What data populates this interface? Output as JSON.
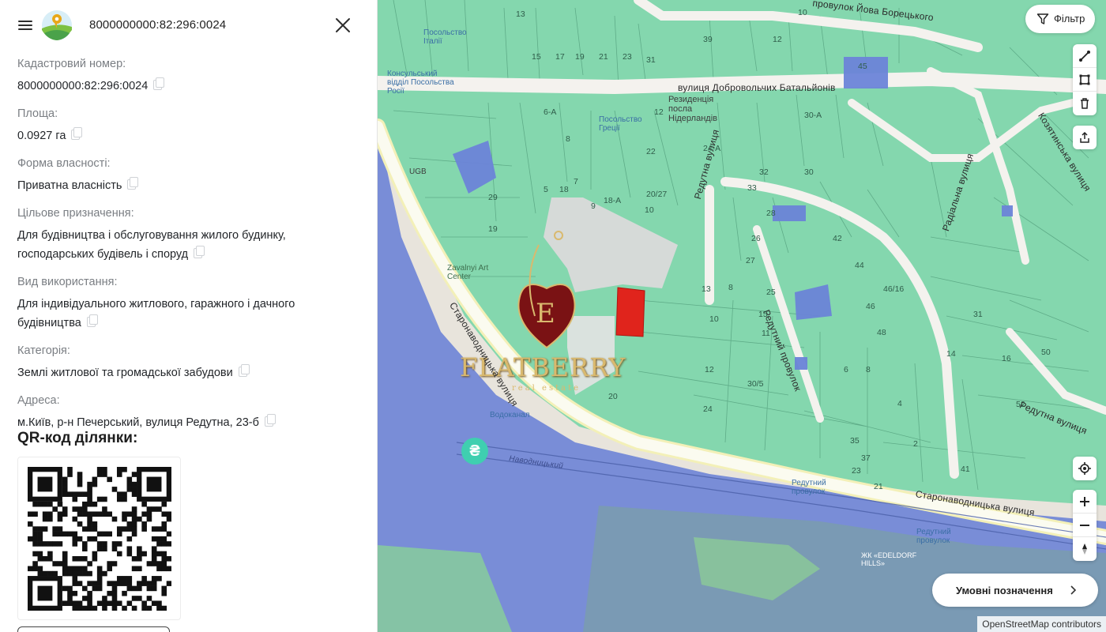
{
  "header": {
    "title": "8000000000:82:296:0024"
  },
  "fields": [
    {
      "label": "Кадастровий номер:",
      "value": "8000000000:82:296:0024"
    },
    {
      "label": "Площа:",
      "value": "0.0927 га"
    },
    {
      "label": "Форма власності:",
      "value": "Приватна власність"
    },
    {
      "label": "Цільове призначення:",
      "value": "Для будівництва і обслуговування жилого будинку, господарських будівель і споруд"
    },
    {
      "label": "Вид використання:",
      "value": "Для індивідуального житлового, гаражного і дачного будівництва"
    },
    {
      "label": "Категорія:",
      "value": "Землі житлової та громадської забудови"
    },
    {
      "label": "Адреса:",
      "value": "м.Київ, р-н Печерський, вулиця Редутна, 23-б"
    }
  ],
  "qr": {
    "title": "QR-код ділянки:"
  },
  "map": {
    "filter_label": "Фільтр",
    "legend_label": "Умовні позначення",
    "attribution": "OpenStreetMap contributors",
    "currency_symbol": "₴",
    "watermark_text": "FLATBERRY",
    "watermark_sub": "real estate",
    "streets": [
      "провулок Йова Борецького",
      "вулиця Добровольчих Батальйонів",
      "Редутна вулиця",
      "Редутний провулок",
      "Радіальна вулиця",
      "Козятинська вулиця",
      "Старонаводницька вулиця",
      "Старонаводницька вулиця",
      "Редутна вулиця",
      "Наводницький"
    ],
    "places": [
      "Посольство Італії",
      "Консульський відділ Посольства Росії",
      "Посольство Греції",
      "Резиденція посла Нідерландів",
      "UGB",
      "Zavalnyi Art Center",
      "Водоканал",
      "Редутний провулок",
      "Редутний провулок",
      "ЖК «EDELDORF HILLS»"
    ],
    "parcel_numbers": [
      "13",
      "39",
      "15",
      "17",
      "19",
      "21",
      "23",
      "31",
      "6-А",
      "8",
      "12",
      "24-А",
      "18",
      "22",
      "20/27",
      "10",
      "18-А",
      "5",
      "7",
      "9",
      "29",
      "19",
      "20",
      "24",
      "30-А",
      "30",
      "32",
      "33",
      "28",
      "26",
      "45",
      "42",
      "44",
      "46",
      "48",
      "31",
      "14",
      "16",
      "50",
      "52",
      "4",
      "2",
      "41",
      "37",
      "35",
      "6",
      "8",
      "27",
      "25",
      "15",
      "11",
      "13",
      "8",
      "10",
      "12",
      "30/5",
      "23",
      "21",
      "10",
      "12",
      "46/16"
    ],
    "colors": {
      "parcel_green": "#7ed6ab",
      "parcel_blue": "#6b84d8",
      "selected_parcel": "#e0241c",
      "road": "#ffffff"
    }
  }
}
